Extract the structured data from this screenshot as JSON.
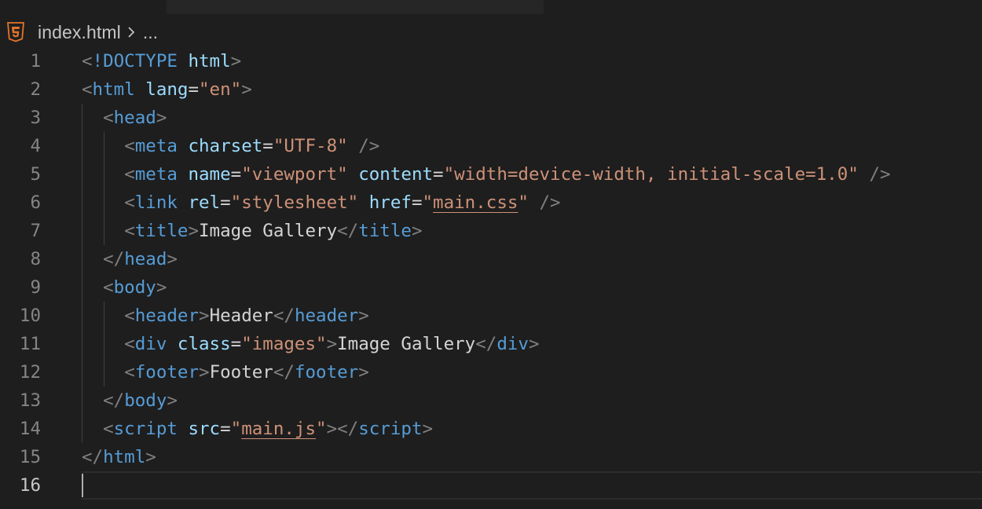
{
  "breadcrumb": {
    "file_icon": "html5-file-icon",
    "file": "index.html",
    "separator_icon": "chevron-right-icon",
    "more": "..."
  },
  "editor": {
    "language": "html",
    "current_line": 16,
    "lines": [
      {
        "n": "1",
        "tokens": [
          {
            "t": "punct",
            "v": "<"
          },
          {
            "t": "tag",
            "v": "!DOCTYPE"
          },
          {
            "t": "text",
            "v": " "
          },
          {
            "t": "attr",
            "v": "html"
          },
          {
            "t": "punct",
            "v": ">"
          }
        ]
      },
      {
        "n": "2",
        "tokens": [
          {
            "t": "punct",
            "v": "<"
          },
          {
            "t": "tag",
            "v": "html"
          },
          {
            "t": "text",
            "v": " "
          },
          {
            "t": "attr",
            "v": "lang"
          },
          {
            "t": "text",
            "v": "="
          },
          {
            "t": "str",
            "v": "\"en\""
          },
          {
            "t": "punct",
            "v": ">"
          }
        ]
      },
      {
        "n": "3",
        "indent": "  ",
        "guides": 1,
        "tokens": [
          {
            "t": "punct",
            "v": "<"
          },
          {
            "t": "tag",
            "v": "head"
          },
          {
            "t": "punct",
            "v": ">"
          }
        ]
      },
      {
        "n": "4",
        "indent": "    ",
        "guides": 2,
        "tokens": [
          {
            "t": "punct",
            "v": "<"
          },
          {
            "t": "tag",
            "v": "meta"
          },
          {
            "t": "text",
            "v": " "
          },
          {
            "t": "attr",
            "v": "charset"
          },
          {
            "t": "text",
            "v": "="
          },
          {
            "t": "str",
            "v": "\"UTF-8\""
          },
          {
            "t": "text",
            "v": " "
          },
          {
            "t": "punct",
            "v": "/>"
          }
        ]
      },
      {
        "n": "5",
        "indent": "    ",
        "guides": 2,
        "tokens": [
          {
            "t": "punct",
            "v": "<"
          },
          {
            "t": "tag",
            "v": "meta"
          },
          {
            "t": "text",
            "v": " "
          },
          {
            "t": "attr",
            "v": "name"
          },
          {
            "t": "text",
            "v": "="
          },
          {
            "t": "str",
            "v": "\"viewport\""
          },
          {
            "t": "text",
            "v": " "
          },
          {
            "t": "attr",
            "v": "content"
          },
          {
            "t": "text",
            "v": "="
          },
          {
            "t": "str",
            "v": "\"width=device-width, initial-scale=1.0\""
          },
          {
            "t": "text",
            "v": " "
          },
          {
            "t": "punct",
            "v": "/>"
          }
        ]
      },
      {
        "n": "6",
        "indent": "    ",
        "guides": 2,
        "tokens": [
          {
            "t": "punct",
            "v": "<"
          },
          {
            "t": "tag",
            "v": "link"
          },
          {
            "t": "text",
            "v": " "
          },
          {
            "t": "attr",
            "v": "rel"
          },
          {
            "t": "text",
            "v": "="
          },
          {
            "t": "str",
            "v": "\"stylesheet\""
          },
          {
            "t": "text",
            "v": " "
          },
          {
            "t": "attr",
            "v": "href"
          },
          {
            "t": "text",
            "v": "="
          },
          {
            "t": "str",
            "v": "\""
          },
          {
            "t": "link",
            "v": "main.css"
          },
          {
            "t": "str",
            "v": "\""
          },
          {
            "t": "text",
            "v": " "
          },
          {
            "t": "punct",
            "v": "/>"
          }
        ]
      },
      {
        "n": "7",
        "indent": "    ",
        "guides": 2,
        "tokens": [
          {
            "t": "punct",
            "v": "<"
          },
          {
            "t": "tag",
            "v": "title"
          },
          {
            "t": "punct",
            "v": ">"
          },
          {
            "t": "text",
            "v": "Image Gallery"
          },
          {
            "t": "punct",
            "v": "</"
          },
          {
            "t": "tag",
            "v": "title"
          },
          {
            "t": "punct",
            "v": ">"
          }
        ]
      },
      {
        "n": "8",
        "indent": "  ",
        "guides": 1,
        "tokens": [
          {
            "t": "punct",
            "v": "</"
          },
          {
            "t": "tag",
            "v": "head"
          },
          {
            "t": "punct",
            "v": ">"
          }
        ]
      },
      {
        "n": "9",
        "indent": "  ",
        "guides": 1,
        "tokens": [
          {
            "t": "punct",
            "v": "<"
          },
          {
            "t": "tag",
            "v": "body"
          },
          {
            "t": "punct",
            "v": ">"
          }
        ]
      },
      {
        "n": "10",
        "indent": "    ",
        "guides": 2,
        "tokens": [
          {
            "t": "punct",
            "v": "<"
          },
          {
            "t": "tag",
            "v": "header"
          },
          {
            "t": "punct",
            "v": ">"
          },
          {
            "t": "text",
            "v": "Header"
          },
          {
            "t": "punct",
            "v": "</"
          },
          {
            "t": "tag",
            "v": "header"
          },
          {
            "t": "punct",
            "v": ">"
          }
        ]
      },
      {
        "n": "11",
        "indent": "    ",
        "guides": 2,
        "tokens": [
          {
            "t": "punct",
            "v": "<"
          },
          {
            "t": "tag",
            "v": "div"
          },
          {
            "t": "text",
            "v": " "
          },
          {
            "t": "attr",
            "v": "class"
          },
          {
            "t": "text",
            "v": "="
          },
          {
            "t": "str",
            "v": "\"images\""
          },
          {
            "t": "punct",
            "v": ">"
          },
          {
            "t": "text",
            "v": "Image Gallery"
          },
          {
            "t": "punct",
            "v": "</"
          },
          {
            "t": "tag",
            "v": "div"
          },
          {
            "t": "punct",
            "v": ">"
          }
        ]
      },
      {
        "n": "12",
        "indent": "    ",
        "guides": 2,
        "tokens": [
          {
            "t": "punct",
            "v": "<"
          },
          {
            "t": "tag",
            "v": "footer"
          },
          {
            "t": "punct",
            "v": ">"
          },
          {
            "t": "text",
            "v": "Footer"
          },
          {
            "t": "punct",
            "v": "</"
          },
          {
            "t": "tag",
            "v": "footer"
          },
          {
            "t": "punct",
            "v": ">"
          }
        ]
      },
      {
        "n": "13",
        "indent": "  ",
        "guides": 1,
        "tokens": [
          {
            "t": "punct",
            "v": "</"
          },
          {
            "t": "tag",
            "v": "body"
          },
          {
            "t": "punct",
            "v": ">"
          }
        ]
      },
      {
        "n": "14",
        "indent": "  ",
        "guides": 1,
        "tokens": [
          {
            "t": "punct",
            "v": "<"
          },
          {
            "t": "tag",
            "v": "script"
          },
          {
            "t": "text",
            "v": " "
          },
          {
            "t": "attr",
            "v": "src"
          },
          {
            "t": "text",
            "v": "="
          },
          {
            "t": "str",
            "v": "\""
          },
          {
            "t": "link",
            "v": "main.js"
          },
          {
            "t": "str",
            "v": "\""
          },
          {
            "t": "punct",
            "v": "></"
          },
          {
            "t": "tag",
            "v": "script"
          },
          {
            "t": "punct",
            "v": ">"
          }
        ]
      },
      {
        "n": "15",
        "tokens": [
          {
            "t": "punct",
            "v": "</"
          },
          {
            "t": "tag",
            "v": "html"
          },
          {
            "t": "punct",
            "v": ">"
          }
        ]
      },
      {
        "n": "16",
        "tokens": []
      }
    ]
  },
  "colors": {
    "background": "#1e1e1e",
    "tag": "#569cd6",
    "attribute": "#9cdcfe",
    "string": "#ce9178",
    "punctuation": "#808080",
    "text": "#d4d4d4",
    "line_number": "#858585"
  }
}
